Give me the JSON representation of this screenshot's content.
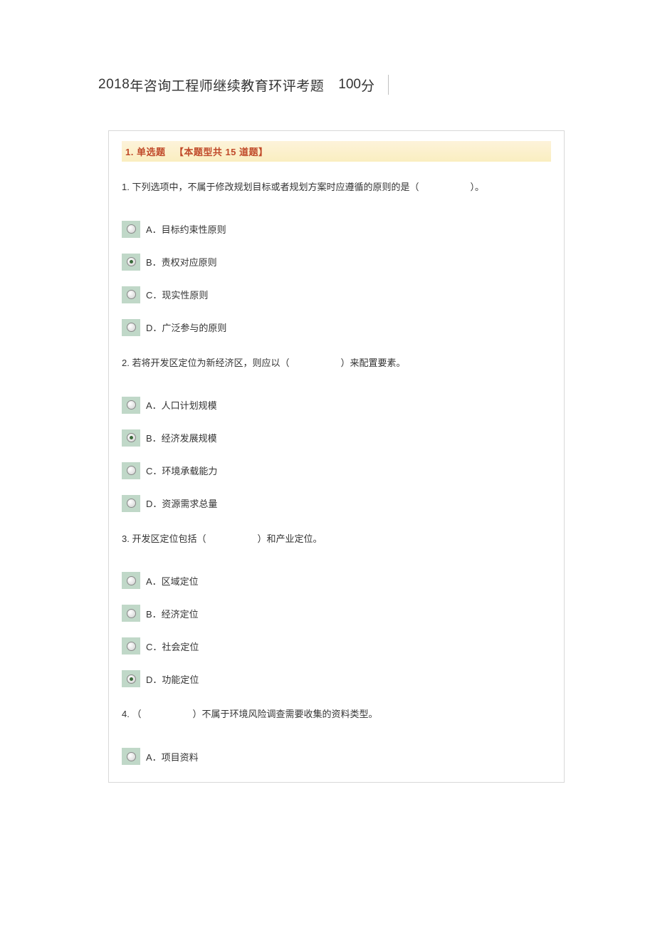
{
  "header": {
    "title_prefix": "2018",
    "title_main": " 年咨询工程师继续教育环评考题",
    "score_number": "100",
    "score_suffix": " 分"
  },
  "section": {
    "number": "1.",
    "label": "单选题",
    "note": "【本题型共 15 道题】"
  },
  "questions": [
    {
      "num": "1.",
      "text_before": "下列选项中，不属于修改规划目标或者规划方案时应遵循的原则的是（",
      "text_after": "）。",
      "options": [
        {
          "letter": "A．",
          "text": "目标约束性原则",
          "selected": false
        },
        {
          "letter": "B．",
          "text": "责权对应原则",
          "selected": true
        },
        {
          "letter": "C．",
          "text": "现实性原则",
          "selected": false
        },
        {
          "letter": "D．",
          "text": "广泛参与的原则",
          "selected": false
        }
      ]
    },
    {
      "num": "2.",
      "text_before": "若将开发区定位为新经济区，则应以（",
      "text_after": "）来配置要素。",
      "options": [
        {
          "letter": "A．",
          "text": "人口计划规模",
          "selected": false
        },
        {
          "letter": "B．",
          "text": "经济发展规模",
          "selected": true
        },
        {
          "letter": "C．",
          "text": "环境承载能力",
          "selected": false
        },
        {
          "letter": "D．",
          "text": "资源需求总量",
          "selected": false
        }
      ]
    },
    {
      "num": "3.",
      "text_before": "开发区定位包括（",
      "text_after": "）和产业定位。",
      "options": [
        {
          "letter": "A．",
          "text": "区域定位",
          "selected": false
        },
        {
          "letter": "B．",
          "text": "经济定位",
          "selected": false
        },
        {
          "letter": "C．",
          "text": "社会定位",
          "selected": false
        },
        {
          "letter": "D．",
          "text": "功能定位",
          "selected": true
        }
      ]
    },
    {
      "num": "4.",
      "text_before": "（",
      "text_after": "）不属于环境风险调查需要收集的资料类型。",
      "options": [
        {
          "letter": "A．",
          "text": "项目资料",
          "selected": false
        }
      ]
    }
  ]
}
